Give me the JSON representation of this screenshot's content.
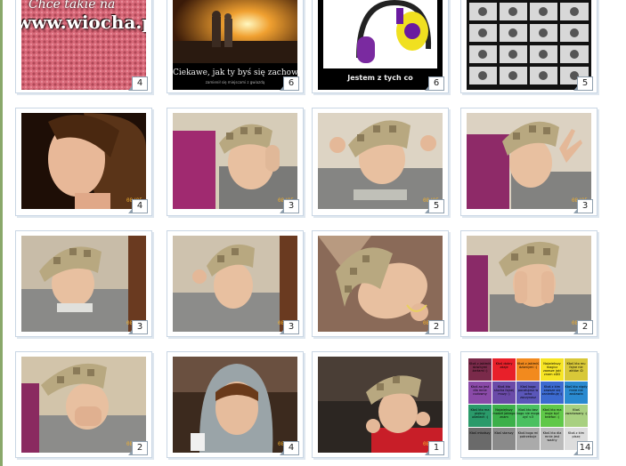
{
  "watermark": {
    "site": "www.wiocha.pl",
    "top_text": "Chce takie na"
  },
  "tiles": [
    {
      "count": "4"
    },
    {
      "count": "6",
      "caption": "Ciekawe, jak ty byś się zachowywał, gd",
      "subcaption": "zamienił się miejscami z gwiazdą"
    },
    {
      "count": "6",
      "caption": "Jestem z tych co"
    },
    {
      "count": "5"
    },
    {
      "count": "4",
      "stamp": "08/05"
    },
    {
      "count": "3",
      "stamp": "08/05"
    },
    {
      "count": "5",
      "stamp": "08/05"
    },
    {
      "count": "3",
      "stamp": "08/05"
    },
    {
      "count": "3",
      "stamp": "08/05"
    },
    {
      "count": "3",
      "stamp": "08/05"
    },
    {
      "count": "2",
      "stamp": "08/05"
    },
    {
      "count": "2",
      "stamp": "08/05"
    },
    {
      "count": "2",
      "stamp": "08/05"
    },
    {
      "count": "4",
      "stamp": "08/05"
    },
    {
      "count": "1",
      "stamp": "08/05"
    },
    {
      "count": "14"
    }
  ],
  "grid_cells": [
    {
      "text": "Ktoś z jakimiś dziwnymi żartami :)",
      "color": "#7a2a4a"
    },
    {
      "text": "Ktoś dobry zdaje",
      "color": "#e8202a"
    },
    {
      "text": "Ktoś z jakimiś dziwnymi :)",
      "color": "#f28a1e"
    },
    {
      "text": "Najwiekszy magicz zawsze jaki znam xDD",
      "color": "#f6e424"
    },
    {
      "text": "Ktoś kto mu fajne nie aktów :D",
      "color": "#d8c838"
    },
    {
      "text": "Ktoś ao jest dla mnie cudowny",
      "color": "#8a4aa8"
    },
    {
      "text": "Ktoś kto słucha fajnej muzy :)",
      "color": "#6a4aa8"
    },
    {
      "text": "Ktoś kogo pocałujesz w ucho zaczynasz",
      "color": "#5a56b8"
    },
    {
      "text": "Ktoś z kim zawsze się zaniedbuję :)",
      "color": "#3c6ad0"
    },
    {
      "text": "Ktoś kto nigdy mnie nie zostawia",
      "color": "#2a8ad0"
    },
    {
      "text": "Ktoś kto ma piękny uśmiech :)",
      "color": "#2a9a6a"
    },
    {
      "text": "Największy modził jakiego znam",
      "color": "#3cb04a"
    },
    {
      "text": "Ktoś kto bez kogo nie mogę żyć <3",
      "color": "#4ac060"
    },
    {
      "text": "Ktoś kto ma moje być telefon :)",
      "color": "#60c848"
    },
    {
      "text": "Ktoś zwariowany :)",
      "color": "#a8d080"
    },
    {
      "text": "Ktoś młodszy",
      "color": "#6a6a6a"
    },
    {
      "text": "Ktoś starszy",
      "color": "#8a8a8a"
    },
    {
      "text": "Ktoś kogo mi potrzebuje",
      "color": "#aaaaaa"
    },
    {
      "text": "Ktoś kto dla mnie jest ważny",
      "color": "#bbbbbb"
    },
    {
      "text": "Ktoś z kim piszę",
      "color": "#dddddd"
    }
  ]
}
